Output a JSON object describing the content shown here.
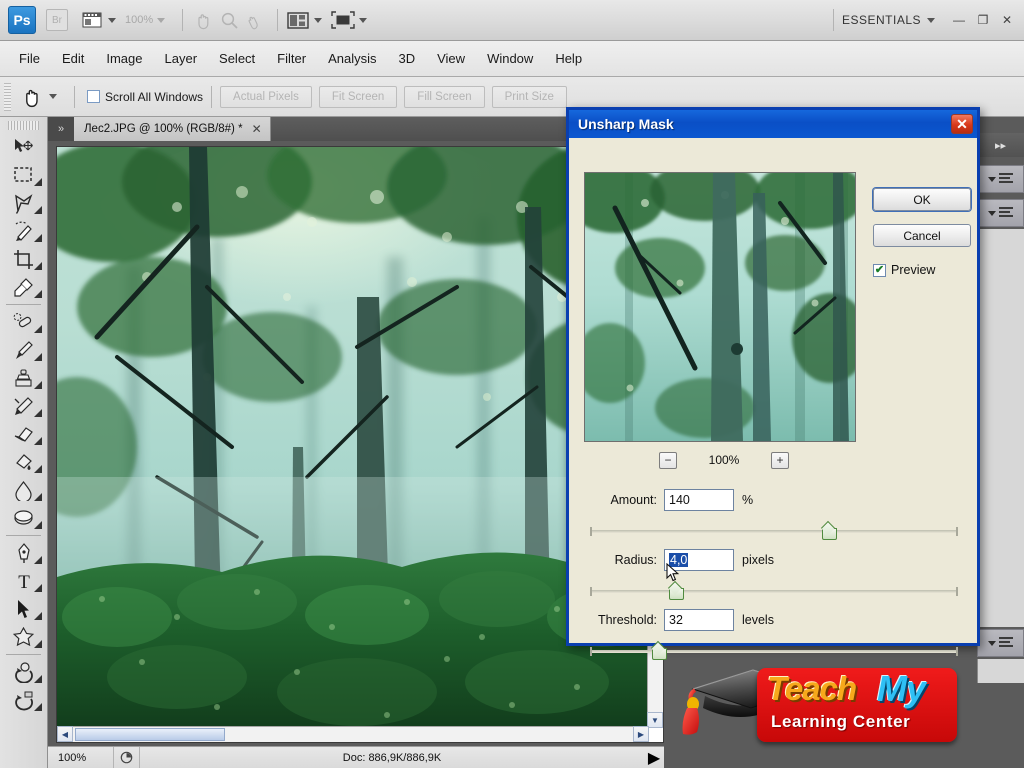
{
  "app": {
    "name": "Adobe Photoshop",
    "logo_text": "Ps",
    "bridge_text": "Br",
    "zoom_display": "100%",
    "workspace": "ESSENTIALS",
    "window_buttons": {
      "minimize": "—",
      "maximize": "❐",
      "close": "✕"
    }
  },
  "menubar": {
    "items": [
      "File",
      "Edit",
      "Image",
      "Layer",
      "Select",
      "Filter",
      "Analysis",
      "3D",
      "View",
      "Window",
      "Help"
    ]
  },
  "options_bar": {
    "active_tool": "hand-tool",
    "scroll_all_windows_label": "Scroll All Windows",
    "scroll_all_windows_checked": false,
    "buttons": [
      "Actual Pixels",
      "Fit Screen",
      "Fill Screen",
      "Print Size"
    ]
  },
  "tools": [
    {
      "name": "move-tool",
      "label": "Move"
    },
    {
      "name": "marquee-tool",
      "label": "Rectangular Marquee"
    },
    {
      "name": "lasso-tool",
      "label": "Lasso"
    },
    {
      "name": "quick-selection-tool",
      "label": "Quick Selection"
    },
    {
      "name": "crop-tool",
      "label": "Crop"
    },
    {
      "name": "eyedropper-tool",
      "label": "Eyedropper"
    },
    {
      "name": "healing-brush-tool",
      "label": "Spot Healing Brush"
    },
    {
      "name": "brush-tool",
      "label": "Brush"
    },
    {
      "name": "clone-stamp-tool",
      "label": "Clone Stamp"
    },
    {
      "name": "history-brush-tool",
      "label": "History Brush"
    },
    {
      "name": "eraser-tool",
      "label": "Eraser"
    },
    {
      "name": "gradient-tool",
      "label": "Paint Bucket"
    },
    {
      "name": "blur-tool",
      "label": "Blur"
    },
    {
      "name": "dodge-tool",
      "label": "Dodge"
    },
    {
      "name": "pen-tool",
      "label": "Pen"
    },
    {
      "name": "type-tool",
      "label": "Horizontal Type"
    },
    {
      "name": "path-selection-tool",
      "label": "Path Selection"
    },
    {
      "name": "shape-tool",
      "label": "Custom Shape"
    },
    {
      "name": "rotate-3d-tool",
      "label": "3D Rotate"
    },
    {
      "name": "orbit-3d-tool",
      "label": "3D Orbit"
    }
  ],
  "document": {
    "tab_title": "Лес2.JPG @ 100% (RGB/8#) *",
    "tab_close": "✕",
    "collapse_icon": "»"
  },
  "status_bar": {
    "zoom": "100%",
    "doc_info": "Doc: 886,9K/886,9K",
    "play_icon": "▶"
  },
  "dialog": {
    "title": "Unsharp Mask",
    "close_label": "✕",
    "ok_label": "OK",
    "cancel_label": "Cancel",
    "preview_label": "Preview",
    "preview_checked": true,
    "preview_check_glyph": "✔",
    "zoom_out_label": "−",
    "zoom_in_label": "+",
    "preview_zoom": "100%",
    "fields": [
      {
        "name": "amount",
        "label": "Amount:",
        "value": "140",
        "unit": "%",
        "selected": false,
        "slider_percent": 65
      },
      {
        "name": "radius",
        "label": "Radius:",
        "value": "4,0",
        "unit": "pixels",
        "selected": true,
        "slider_percent": 27
      },
      {
        "name": "threshold",
        "label": "Threshold:",
        "value": "32",
        "unit": "levels",
        "selected": false,
        "slider_percent": 18
      }
    ]
  },
  "logo": {
    "word_one": "Teach",
    "word_two": "My",
    "subtitle": "Learning Center",
    "color_one": "#f7a81b",
    "color_two": "#2fc0f5",
    "plate_color": "#e01212"
  },
  "colors": {
    "title_bar_blue": "#0b57d0",
    "dialog_border": "#0a3fb0",
    "panel_gray": "#ece9d8",
    "workspace_gray": "#5b5b5b",
    "selection_blue": "#1b4ea8"
  }
}
